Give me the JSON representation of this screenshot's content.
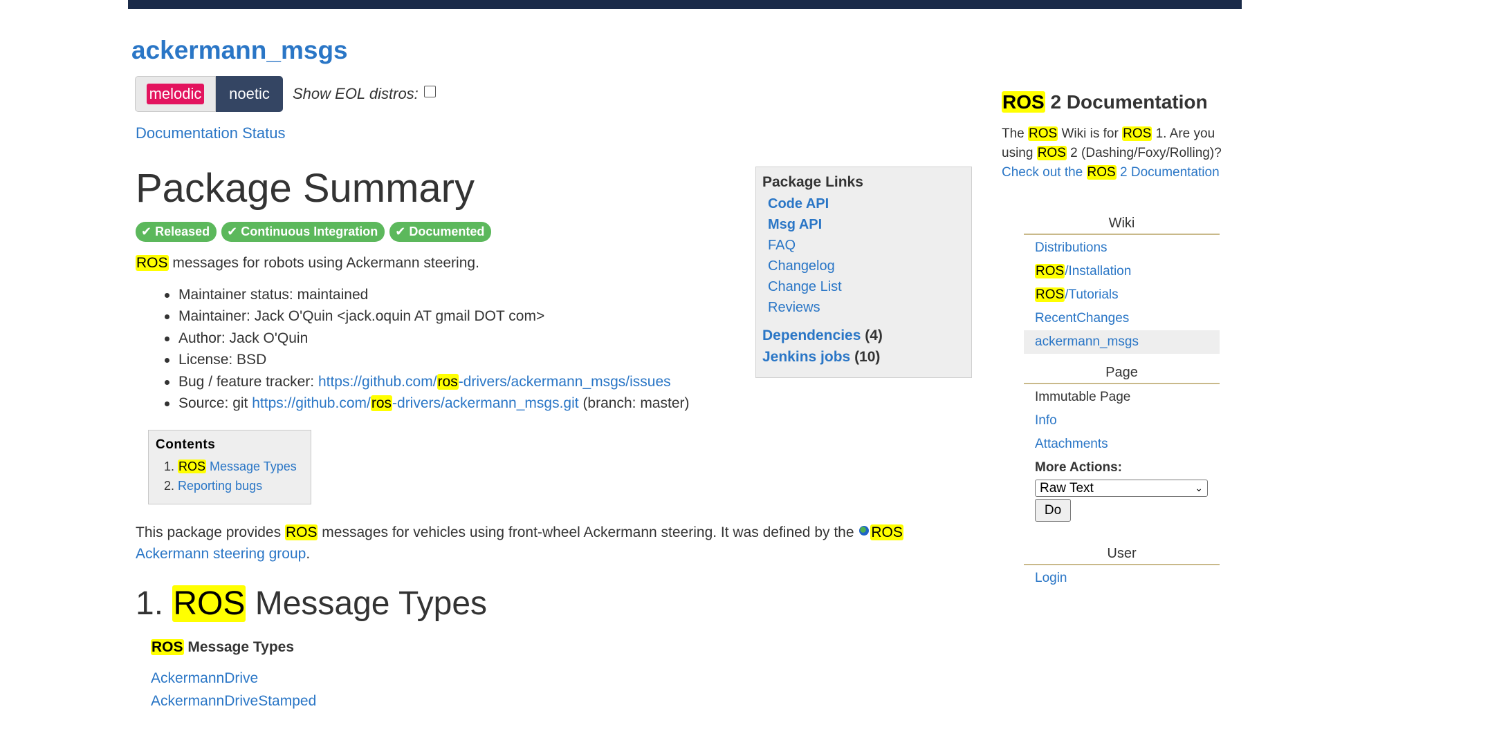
{
  "package": {
    "name": "ackermann_msgs",
    "distros": [
      "melodic",
      "noetic"
    ],
    "eol_label": "Show EOL distros:",
    "doc_status": "Documentation Status"
  },
  "summary": {
    "heading": "Package Summary",
    "badges": [
      "Released",
      "Continuous Integration",
      "Documented"
    ],
    "desc_hl": "ROS",
    "desc_rest": " messages for robots using Ackermann steering.",
    "meta": {
      "status": "Maintainer status: maintained",
      "maintainer": "Maintainer: Jack O'Quin <jack.oquin AT gmail DOT com>",
      "author": "Author: Jack O'Quin",
      "license": "License: BSD",
      "bug_label": "Bug / feature tracker: ",
      "bug_url_a": "https://github.com/",
      "bug_url_hl": "ros",
      "bug_url_b": "-drivers/ackermann_msgs/issues",
      "src_label": "Source: git ",
      "src_url_a": "https://github.com/",
      "src_url_hl": "ros",
      "src_url_b": "-drivers/ackermann_msgs.git",
      "src_branch": " (branch: master)"
    }
  },
  "contents": {
    "title": "Contents",
    "item1_hl": "ROS",
    "item1_rest": " Message Types",
    "item2": "Reporting bugs"
  },
  "paragraph": {
    "t1": "This package provides ",
    "hl1": "ROS",
    "t2": " messages for vehicles using front-wheel Ackermann steering. It was defined by the ",
    "link_hl": "ROS",
    "link_rest": "Ackermann steering group",
    "t3": "."
  },
  "section": {
    "num": "1. ",
    "hl": "ROS",
    "rest": " Message Types",
    "sub_hl": "ROS",
    "sub_rest": " Message Types",
    "links": [
      "AckermannDrive",
      "AckermannDriveStamped"
    ]
  },
  "package_links": {
    "title": "Package Links",
    "items": [
      "Code API",
      "Msg API",
      "FAQ",
      "Changelog",
      "Change List",
      "Reviews"
    ],
    "dependencies_label": "Dependencies",
    "dependencies_count": "(4)",
    "jenkins_label": "Jenkins jobs",
    "jenkins_count": "(10)"
  },
  "ros2": {
    "heading_hl": "ROS",
    "heading_rest": " 2 Documentation",
    "p_t1": "The ",
    "p_hl1": "ROS",
    "p_t2": " Wiki is for ",
    "p_hl2": "ROS",
    "p_t3": " 1. Are you using ",
    "p_hl3": "ROS",
    "p_t4": " 2 (Dashing/Foxy/Rolling)? ",
    "p_link_a": "Check out the ",
    "p_link_hl": "ROS",
    "p_link_b": " 2 Documentation"
  },
  "sidebar": {
    "wiki_head": "Wiki",
    "wiki_items": {
      "distributions": "Distributions",
      "install_hl": "ROS",
      "install_rest": "/Installation",
      "tut_hl": "ROS",
      "tut_rest": "/Tutorials",
      "recent": "RecentChanges",
      "current": "ackermann_msgs"
    },
    "page_head": "Page",
    "page_items": {
      "immutable": "Immutable Page",
      "info": "Info",
      "attachments": "Attachments",
      "more_actions": "More Actions:",
      "select_value": "Raw Text",
      "do": "Do"
    },
    "user_head": "User",
    "login": "Login"
  },
  "colors": {
    "link": "#2a76c6",
    "highlight": "#ffff00",
    "badge": "#5cb85c",
    "melodic": "#e3145e",
    "noetic": "#344563",
    "topbar": "#1b2b49"
  }
}
